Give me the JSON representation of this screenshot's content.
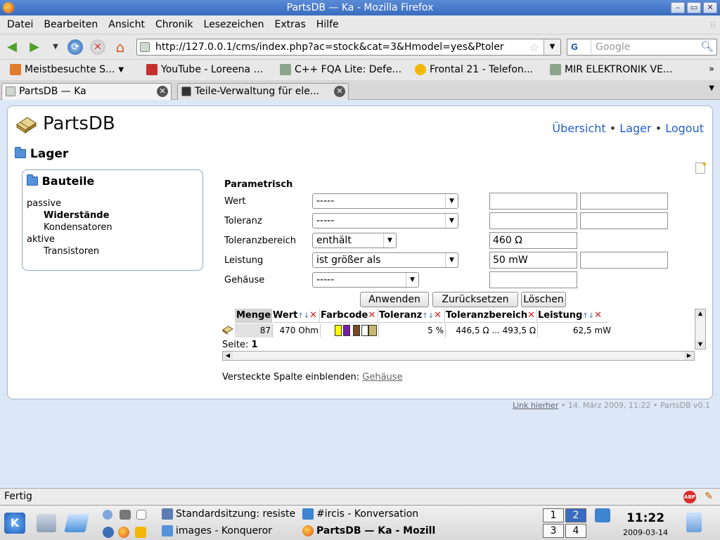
{
  "window": {
    "title": "PartsDB — Ka - Mozilla Firefox"
  },
  "menu": [
    {
      "label": "Datei"
    },
    {
      "label": "Bearbeiten"
    },
    {
      "label": "Ansicht"
    },
    {
      "label": "Chronik"
    },
    {
      "label": "Lesezeichen"
    },
    {
      "label": "Extras"
    },
    {
      "label": "Hilfe"
    }
  ],
  "nav": {
    "url": "http://127.0.0.1/cms/index.php?ac=stock&cat=3&Hmodel=yes&Ptoler",
    "search_placeholder": "Google",
    "search_engine": "G"
  },
  "bookmarks": [
    {
      "label": "Meistbesuchte S...",
      "icon": "folder-icon",
      "color": "#e07b2a"
    },
    {
      "label": "YouTube - Loreena ...",
      "icon": "youtube-icon",
      "color": "#c4302b"
    },
    {
      "label": "C++ FQA Lite: Defe...",
      "icon": "page-icon",
      "color": "#8ca38c"
    },
    {
      "label": "Frontal 21 - Telefon...",
      "icon": "smiley-icon",
      "color": "#f2b705"
    },
    {
      "label": "MIR ELEKTRONIK VE...",
      "icon": "page-icon",
      "color": "#8ca38c"
    }
  ],
  "bookmarks_more": "»",
  "tabs": [
    {
      "label": "PartsDB — Ka",
      "active": true
    },
    {
      "label": "Teile-Verwaltung für ele..."
    }
  ],
  "page": {
    "site_title": "PartsDB",
    "topnav": {
      "overview": "Übersicht",
      "stock": "Lager",
      "logout": "Logout",
      "sep": "•"
    },
    "section_title": "Lager",
    "categories_title": "Bauteile",
    "categories": [
      {
        "label": "passive",
        "indent": 0,
        "bold": false
      },
      {
        "label": "Widerstände",
        "indent": 1,
        "bold": true
      },
      {
        "label": "Kondensatoren",
        "indent": 1,
        "bold": false
      },
      {
        "label": "aktive",
        "indent": 0,
        "bold": false
      },
      {
        "label": "Transistoren",
        "indent": 1,
        "bold": false
      }
    ],
    "filter": {
      "heading": "Parametrisch",
      "rows": [
        {
          "label": "Wert",
          "op": "-----",
          "v1": "",
          "v2": ""
        },
        {
          "label": "Toleranz",
          "op": "-----",
          "v1": "",
          "v2": ""
        },
        {
          "label": "Toleranzbereich",
          "op": "enthält",
          "v1": "460 Ω"
        },
        {
          "label": "Leistung",
          "op": "ist größer als",
          "v1": "50 mW",
          "v2": ""
        },
        {
          "label": "Gehäuse",
          "op": "-----",
          "v1": ""
        }
      ],
      "buttons": {
        "apply": "Anwenden",
        "reset": "Zurücksetzen",
        "delete": "Löschen"
      }
    },
    "table": {
      "columns": [
        "Menge",
        "Wert",
        "Farbcode",
        "Toleranz",
        "Toleranzbereich",
        "Leistung"
      ],
      "sort_glyphs": "↑↓",
      "remove_glyph": "✕",
      "rows": [
        {
          "menge": "87",
          "wert": "470 Ohm",
          "farbcode": [
            "#ffff00",
            "#7a1fa2",
            "#7a4a1f",
            "#ffffff",
            "#c8b86a"
          ],
          "toleranz": "5 %",
          "toleranzbereich": "446,5 Ω ... 493,5 Ω",
          "leistung": "62,5 mW"
        }
      ],
      "page_label": "Seite:",
      "page_number": "1"
    },
    "hidden_columns": {
      "label": "Versteckte Spalte einblenden:",
      "link": "Gehäuse"
    },
    "footer": {
      "link": "Link hierher",
      "rest": "• 14. März 2009, 11:22 • PartsDB v0.1"
    }
  },
  "status": {
    "text": "Fertig",
    "abp": "ABP"
  },
  "taskbar": {
    "kmenu": "K",
    "tasks": [
      {
        "label": "Standardsitzung: resiste",
        "icon": "konsole-icon"
      },
      {
        "label": "#ircis - Konversation",
        "icon": "konversation-icon"
      },
      {
        "label": "images - Konqueror",
        "icon": "konqueror-icon"
      },
      {
        "label": "PartsDB — Ka - Mozill",
        "icon": "firefox-icon"
      }
    ],
    "pager": [
      "1",
      "2",
      "3",
      "4"
    ],
    "clock": "11:22",
    "date": "2009-03-14"
  }
}
